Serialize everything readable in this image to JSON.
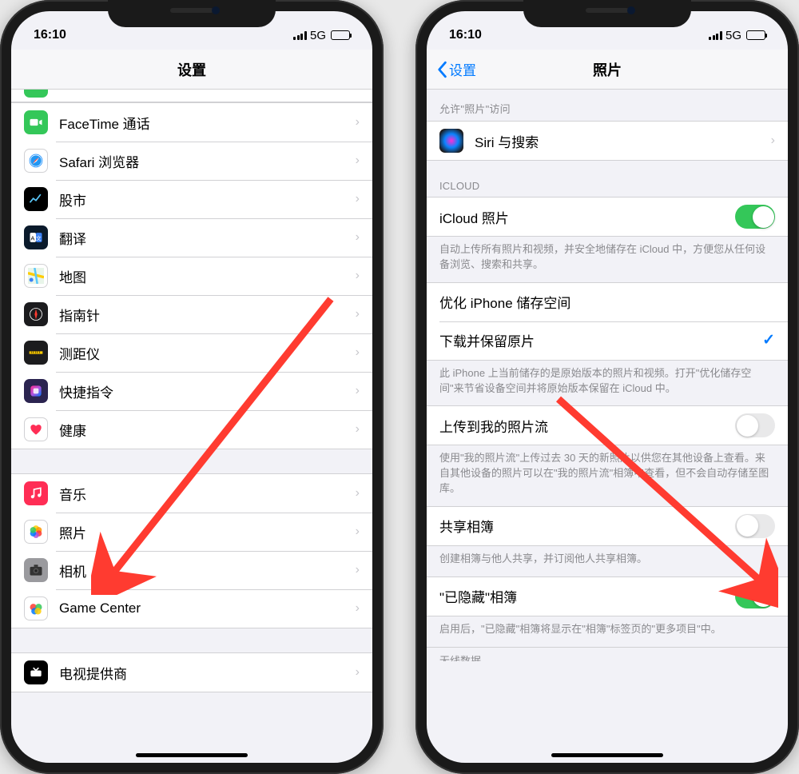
{
  "status": {
    "time": "16:10",
    "network": "5G"
  },
  "left": {
    "title": "设置",
    "groups": [
      {
        "items": [
          {
            "key": "facetime",
            "label": "FaceTime 通话",
            "icon_bg": "#34c759",
            "icon": "video"
          },
          {
            "key": "safari",
            "label": "Safari 浏览器",
            "icon_bg": "#ffffff",
            "icon": "safari"
          },
          {
            "key": "stocks",
            "label": "股市",
            "icon_bg": "#000000",
            "icon": "stocks"
          },
          {
            "key": "translate",
            "label": "翻译",
            "icon_bg": "#0a1a2b",
            "icon": "translate"
          },
          {
            "key": "maps",
            "label": "地图",
            "icon_bg": "#ffffff",
            "icon": "maps"
          },
          {
            "key": "compass",
            "label": "指南针",
            "icon_bg": "#1c1c1e",
            "icon": "compass"
          },
          {
            "key": "measure",
            "label": "测距仪",
            "icon_bg": "#1c1c1e",
            "icon": "measure"
          },
          {
            "key": "shortcuts",
            "label": "快捷指令",
            "icon_bg": "#2b2450",
            "icon": "shortcuts"
          },
          {
            "key": "health",
            "label": "健康",
            "icon_bg": "#ffffff",
            "icon": "health"
          }
        ]
      },
      {
        "items": [
          {
            "key": "music",
            "label": "音乐",
            "icon_bg": "#ff2d55",
            "icon": "music"
          },
          {
            "key": "photos",
            "label": "照片",
            "icon_bg": "#ffffff",
            "icon": "photos"
          },
          {
            "key": "camera",
            "label": "相机",
            "icon_bg": "#9a9a9e",
            "icon": "camera"
          },
          {
            "key": "gamecenter",
            "label": "Game Center",
            "icon_bg": "#ffffff",
            "icon": "gamecenter"
          }
        ]
      },
      {
        "items": [
          {
            "key": "tvprovider",
            "label": "电视提供商",
            "icon_bg": "#000000",
            "icon": "tvprovider"
          }
        ]
      }
    ]
  },
  "right": {
    "back": "设置",
    "title": "照片",
    "allow_access_header": "允许\"照片\"访问",
    "siri": {
      "label": "Siri 与搜索"
    },
    "icloud_header": "ICLOUD",
    "icloud_photos": {
      "label": "iCloud 照片",
      "on": true
    },
    "icloud_footer": "自动上传所有照片和视频，并安全地储存在 iCloud 中，方便您从任何设备浏览、搜索和共享。",
    "optimize": {
      "label": "优化 iPhone 储存空间",
      "checked": false
    },
    "download": {
      "label": "下载并保留原片",
      "checked": true
    },
    "download_footer": "此 iPhone 上当前储存的是原始版本的照片和视频。打开\"优化储存空间\"来节省设备空间并将原始版本保留在 iCloud 中。",
    "photostream": {
      "label": "上传到我的照片流",
      "on": false
    },
    "photostream_footer": "使用\"我的照片流\"上传过去 30 天的新照片以供您在其他设备上查看。来自其他设备的照片可以在\"我的照片流\"相簿中查看，但不会自动存储至图库。",
    "shared_album": {
      "label": "共享相簿",
      "on": false
    },
    "shared_album_footer": "创建相簿与他人共享，并订阅他人共享相簿。",
    "hidden_album": {
      "label": "\"已隐藏\"相簿",
      "on": true
    },
    "hidden_album_footer": "启用后，\"已隐藏\"相簿将显示在\"相簿\"标签页的\"更多项目\"中。",
    "bottom_partial": "无线数据"
  }
}
